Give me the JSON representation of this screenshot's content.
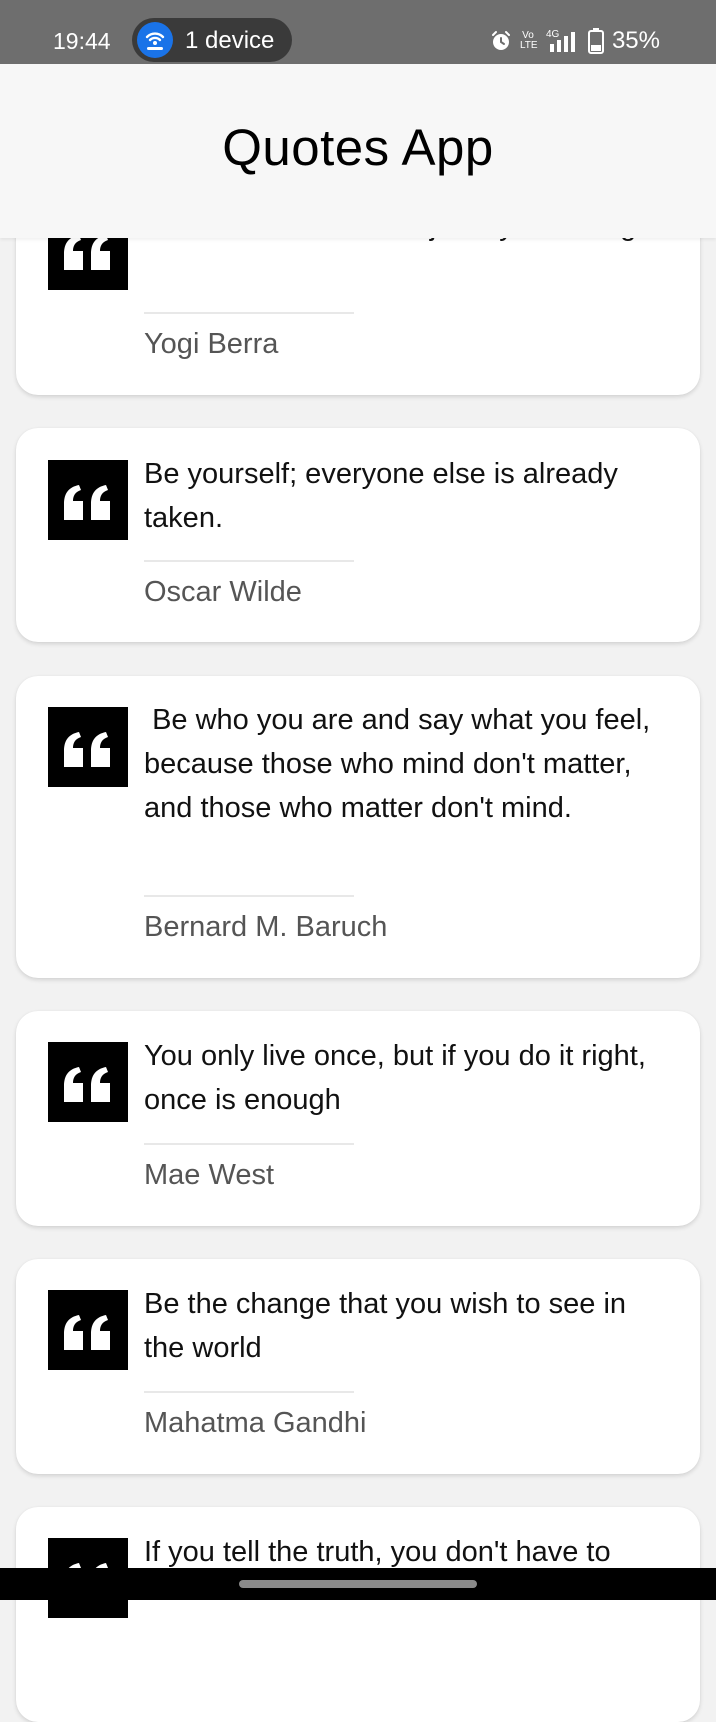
{
  "status_bar": {
    "time": "19:44",
    "hotspot_label": "1 device",
    "network": "4G",
    "volte": "Vo LTE",
    "battery": "35%"
  },
  "header": {
    "title": "Quotes App"
  },
  "quotes": [
    {
      "text": "You can observe a lot just by watching.",
      "author": "Yogi Berra"
    },
    {
      "text": "Be yourself; everyone else is already taken.",
      "author": "Oscar Wilde"
    },
    {
      "text": " Be who you are and say what you feel, because those who mind don't matter, and those who matter don't mind.",
      "author": "Bernard M. Baruch"
    },
    {
      "text": "You only live once, but if you do it right, once is enough",
      "author": "Mae West"
    },
    {
      "text": "Be the change that you wish to see in the world",
      "author": "Mahatma Gandhi"
    },
    {
      "text": "If you tell the truth, you don't have to",
      "author": ""
    }
  ]
}
